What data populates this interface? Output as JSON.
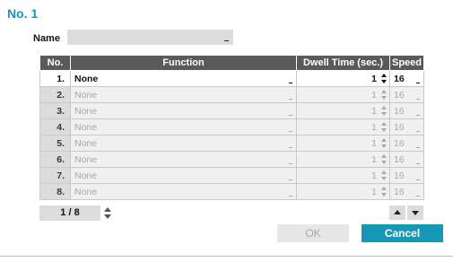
{
  "dialog": {
    "title": "No. 1"
  },
  "name_field": {
    "label": "Name",
    "value": ""
  },
  "table": {
    "headers": {
      "no": "No.",
      "function": "Function",
      "dwell": "Dwell Time (sec.)",
      "speed": "Speed"
    },
    "rows": [
      {
        "no": "1.",
        "function": "None",
        "dwell": "1",
        "speed": "16"
      },
      {
        "no": "2.",
        "function": "None",
        "dwell": "1",
        "speed": "16"
      },
      {
        "no": "3.",
        "function": "None",
        "dwell": "1",
        "speed": "16"
      },
      {
        "no": "4.",
        "function": "None",
        "dwell": "1",
        "speed": "16"
      },
      {
        "no": "5.",
        "function": "None",
        "dwell": "1",
        "speed": "16"
      },
      {
        "no": "6.",
        "function": "None",
        "dwell": "1",
        "speed": "16"
      },
      {
        "no": "7.",
        "function": "None",
        "dwell": "1",
        "speed": "16"
      },
      {
        "no": "8.",
        "function": "None",
        "dwell": "1",
        "speed": "16"
      }
    ]
  },
  "pager": {
    "label": "1 / 8"
  },
  "buttons": {
    "ok": "OK",
    "cancel": "Cancel"
  },
  "colors": {
    "accent": "#1597b6",
    "header_bg": "#5a5a5a",
    "field_bg": "#dcdcdc"
  },
  "icons": {
    "spinner": "up-down-spinner-icon",
    "dropdown": "dropdown-caret-icon",
    "move_up": "arrow-up-icon",
    "move_down": "arrow-down-icon"
  }
}
